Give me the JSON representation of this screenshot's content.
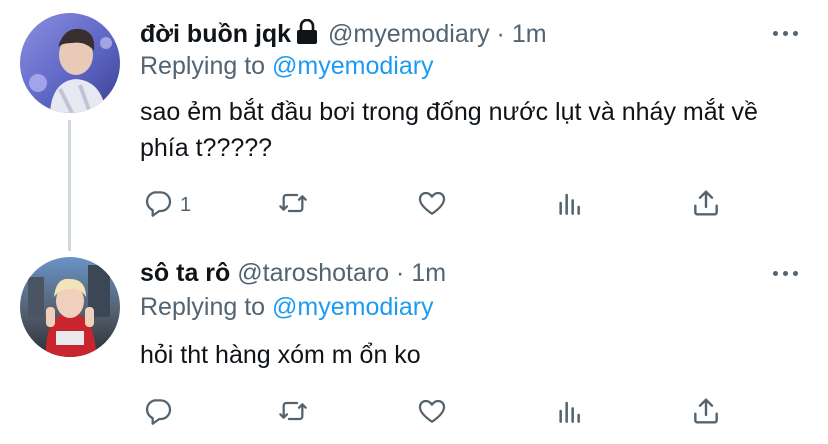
{
  "tweets": [
    {
      "name": "đời buồn jqk",
      "handle": "@myemodiary",
      "dot": "·",
      "time": "1m",
      "replying_prefix": "Replying to",
      "replying_to": "@myemodiary",
      "text": "sao ẻm bắt đầu bơi trong đống nước lụt và nháy mắt về phía t?????",
      "reply_count": "1",
      "locked": true
    },
    {
      "name": "sô ta rô",
      "handle": "@taroshotaro",
      "dot": "·",
      "time": "1m",
      "replying_prefix": "Replying to",
      "replying_to": "@myemodiary",
      "text": "hỏi tht hàng xóm m ổn ko",
      "reply_count": "",
      "locked": false
    }
  ],
  "icons": {
    "reply": "reply-icon",
    "retweet": "retweet-icon",
    "like": "heart-icon",
    "stats": "analytics-icon",
    "share": "share-icon",
    "more": "more-icon",
    "lock": "lock-icon"
  },
  "colors": {
    "link": "#1d9bf0",
    "muted": "#536471",
    "text": "#0f1419",
    "thread_line": "#cfd9de"
  }
}
